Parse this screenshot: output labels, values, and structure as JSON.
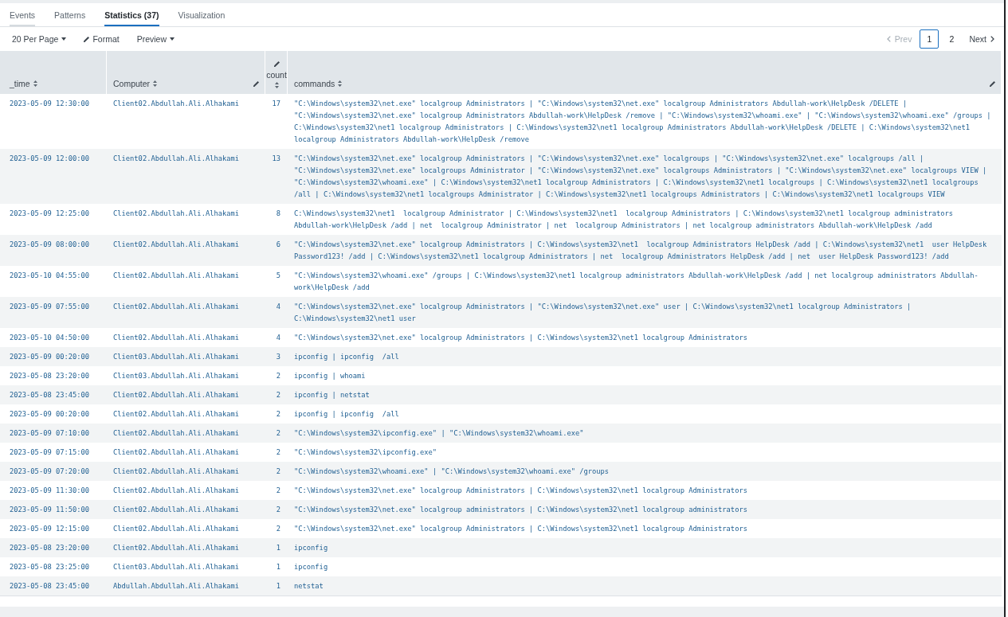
{
  "tabs": [
    {
      "label": "Events",
      "selected": false,
      "hovered": true
    },
    {
      "label": "Patterns",
      "selected": false,
      "hovered": false
    },
    {
      "label": "Statistics (37)",
      "selected": true,
      "hovered": false
    },
    {
      "label": "Visualization",
      "selected": false,
      "hovered": false
    }
  ],
  "toolbar": {
    "per_page": "20 Per Page",
    "format": "Format",
    "preview": "Preview"
  },
  "pagination": {
    "prev": {
      "label": "Prev",
      "disabled": true
    },
    "pages": [
      {
        "label": "1",
        "selected": true
      },
      {
        "label": "2",
        "selected": false
      }
    ],
    "next": {
      "label": "Next",
      "disabled": false
    }
  },
  "table": {
    "columns": [
      {
        "label": "_time",
        "kind": "text",
        "editable": false
      },
      {
        "label": "Computer",
        "kind": "text",
        "editable": true
      },
      {
        "label": "count",
        "kind": "number",
        "editable": true
      },
      {
        "label": "commands",
        "kind": "text",
        "editable": true
      }
    ],
    "rows": [
      {
        "cells": [
          "2023-05-09 12:30:00",
          "Client02.Abdullah.Ali.Alhakami",
          "17",
          "\"C:\\Windows\\system32\\net.exe\" localgroup Administrators | \"C:\\Windows\\system32\\net.exe\" localgroup Administrators Abdullah-work\\HelpDesk /DELETE | \"C:\\Windows\\system32\\net.exe\" localgroup Administrators Abdullah-work\\HelpDesk /remove | \"C:\\Windows\\system32\\whoami.exe\" | \"C:\\Windows\\system32\\whoami.exe\" /groups | C:\\Windows\\system32\\net1 localgroup Administrators | C:\\Windows\\system32\\net1 localgroup Administrators Abdullah-work\\HelpDesk /DELETE | C:\\Windows\\system32\\net1 localgroup Administrators Abdullah-work\\HelpDesk /remove"
        ]
      },
      {
        "cells": [
          "2023-05-09 12:00:00",
          "Client02.Abdullah.Ali.Alhakami",
          "13",
          "\"C:\\Windows\\system32\\net.exe\" localgroup Administrators | \"C:\\Windows\\system32\\net.exe\" localgroups | \"C:\\Windows\\system32\\net.exe\" localgroups /all | \"C:\\Windows\\system32\\net.exe\" localgroups Administrator | \"C:\\Windows\\system32\\net.exe\" localgroups Administrators | \"C:\\Windows\\system32\\net.exe\" localgroups VIEW | \"C:\\Windows\\system32\\whoami.exe\" | C:\\Windows\\system32\\net1 localgroup Administrators | C:\\Windows\\system32\\net1 localgroups | C:\\Windows\\system32\\net1 localgroups /all | C:\\Windows\\system32\\net1 localgroups Administrator | C:\\Windows\\system32\\net1 localgroups Administrators | C:\\Windows\\system32\\net1 localgroups VIEW"
        ]
      },
      {
        "cells": [
          "2023-05-09 12:25:00",
          "Client02.Abdullah.Ali.Alhakami",
          "8",
          "C:\\Windows\\system32\\net1  localgroup Administrator | C:\\Windows\\system32\\net1  localgroup Administrators | C:\\Windows\\system32\\net1 localgroup administrators Abdullah-work\\HelpDesk /add | net  localgroup Administrator | net  localgroup Administrators | net localgroup administrators Abdullah-work\\HelpDesk /add"
        ]
      },
      {
        "cells": [
          "2023-05-09 08:00:00",
          "Client02.Abdullah.Ali.Alhakami",
          "6",
          "\"C:\\Windows\\system32\\net.exe\" localgroup Administrators | C:\\Windows\\system32\\net1  localgroup Administrators HelpDesk /add | C:\\Windows\\system32\\net1  user HelpDesk Password123! /add | C:\\Windows\\system32\\net1 localgroup Administrators | net  localgroup Administrators HelpDesk /add | net  user HelpDesk Password123! /add"
        ]
      },
      {
        "cells": [
          "2023-05-10 04:55:00",
          "Client02.Abdullah.Ali.Alhakami",
          "5",
          "\"C:\\Windows\\system32\\whoami.exe\" /groups | C:\\Windows\\system32\\net1 localgroup administrators Abdullah-work\\HelpDesk /add | net localgroup administrators Abdullah-work\\HelpDesk /add"
        ]
      },
      {
        "cells": [
          "2023-05-09 07:55:00",
          "Client02.Abdullah.Ali.Alhakami",
          "4",
          "\"C:\\Windows\\system32\\net.exe\" localgroup Administrators | \"C:\\Windows\\system32\\net.exe\" user | C:\\Windows\\system32\\net1 localgroup Administrators | C:\\Windows\\system32\\net1 user"
        ]
      },
      {
        "cells": [
          "2023-05-10 04:50:00",
          "Client02.Abdullah.Ali.Alhakami",
          "4",
          "\"C:\\Windows\\system32\\net.exe\" localgroup Administrators | C:\\Windows\\system32\\net1 localgroup Administrators"
        ]
      },
      {
        "cells": [
          "2023-05-09 00:20:00",
          "Client03.Abdullah.Ali.Alhakami",
          "3",
          "ipconfig | ipconfig  /all"
        ]
      },
      {
        "cells": [
          "2023-05-08 23:20:00",
          "Client03.Abdullah.Ali.Alhakami",
          "2",
          "ipconfig | whoami"
        ]
      },
      {
        "cells": [
          "2023-05-08 23:45:00",
          "Client02.Abdullah.Ali.Alhakami",
          "2",
          "ipconfig | netstat"
        ]
      },
      {
        "cells": [
          "2023-05-09 00:20:00",
          "Client02.Abdullah.Ali.Alhakami",
          "2",
          "ipconfig | ipconfig  /all"
        ]
      },
      {
        "cells": [
          "2023-05-09 07:10:00",
          "Client02.Abdullah.Ali.Alhakami",
          "2",
          "\"C:\\Windows\\system32\\ipconfig.exe\" | \"C:\\Windows\\system32\\whoami.exe\""
        ]
      },
      {
        "cells": [
          "2023-05-09 07:15:00",
          "Client02.Abdullah.Ali.Alhakami",
          "2",
          "\"C:\\Windows\\system32\\ipconfig.exe\""
        ]
      },
      {
        "cells": [
          "2023-05-09 07:20:00",
          "Client02.Abdullah.Ali.Alhakami",
          "2",
          "\"C:\\Windows\\system32\\whoami.exe\" | \"C:\\Windows\\system32\\whoami.exe\" /groups"
        ]
      },
      {
        "cells": [
          "2023-05-09 11:30:00",
          "Client02.Abdullah.Ali.Alhakami",
          "2",
          "\"C:\\Windows\\system32\\net.exe\" localgroup Administrators | C:\\Windows\\system32\\net1 localgroup Administrators"
        ]
      },
      {
        "cells": [
          "2023-05-09 11:50:00",
          "Client02.Abdullah.Ali.Alhakami",
          "2",
          "\"C:\\Windows\\system32\\net.exe\" localgroup administrators | C:\\Windows\\system32\\net1 localgroup administrators"
        ]
      },
      {
        "cells": [
          "2023-05-09 12:15:00",
          "Client02.Abdullah.Ali.Alhakami",
          "2",
          "\"C:\\Windows\\system32\\net.exe\" localgroup Administrators | C:\\Windows\\system32\\net1 localgroup Administrators"
        ]
      },
      {
        "cells": [
          "2023-05-08 23:20:00",
          "Client02.Abdullah.Ali.Alhakami",
          "1",
          "ipconfig"
        ]
      },
      {
        "cells": [
          "2023-05-08 23:25:00",
          "Client03.Abdullah.Ali.Alhakami",
          "1",
          "ipconfig"
        ]
      },
      {
        "cells": [
          "2023-05-08 23:45:00",
          "Abdullah.Abdullah.Ali.Alhakami",
          "1",
          "netstat"
        ]
      }
    ]
  }
}
